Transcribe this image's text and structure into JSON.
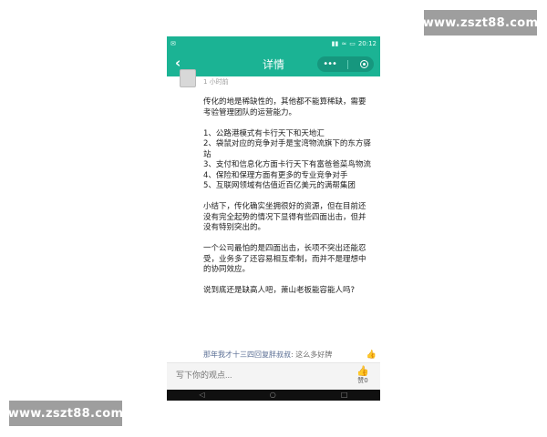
{
  "watermarks": {
    "top_right": "www.zszt88.com",
    "bottom_left": "www.zszt88.com"
  },
  "statusbar": {
    "time": "20:12"
  },
  "header": {
    "back_icon": "chevron-left",
    "title": "详情",
    "more_icon": "more-dots",
    "close_icon": "target-circle"
  },
  "comment": {
    "time": "1 小时前",
    "body": "传化的地是稀缺性的，其他都不能算稀缺，需要考验管理团队的运营能力。\n\n1、公路港模式有卡行天下和天地汇\n2、袋鼠对应的竞争对手是宝湾物流旗下的东方驿站\n3、支付和信息化方面卡行天下有富爸爸菜鸟物流\n4、保险和保理方面有更多的专业竞争对手\n5、互联网领域有估值近百亿美元的满帮集团\n\n小结下，传化确实坐拥很好的资源，但在目前还没有完全起势的情况下显得有些四面出击，但并没有特别突出的。\n\n一个公司最怕的是四面出击，长项不突出还能忍受，业务多了还容易相互牵制，而并不是理想中的协同效应。\n\n说到底还是缺高人吧，萧山老板能容能人吗?",
    "reply": {
      "name": "那年我才十三四回复胖叔叔",
      "text": ": 这么多好牌"
    }
  },
  "input": {
    "placeholder": "写下你的观点..."
  },
  "like": {
    "label": "赞0"
  },
  "colors": {
    "accent": "#1bb394",
    "watermark": "#9e9e9e"
  }
}
